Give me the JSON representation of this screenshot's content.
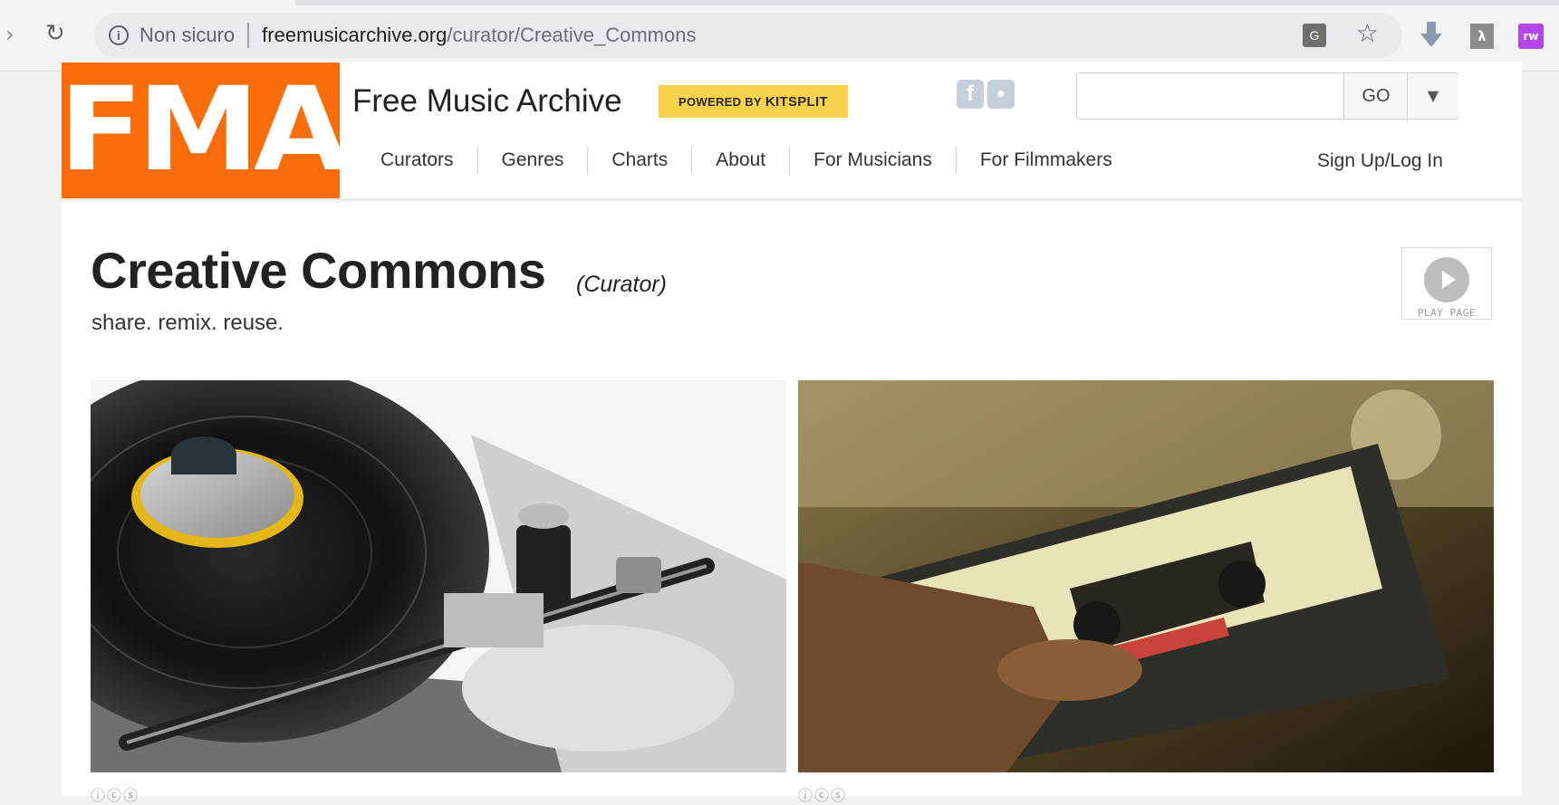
{
  "browser": {
    "security_label": "Non sicuro",
    "url_domain": "freemusicarchive.org",
    "url_path": "/curator/Creative_Commons",
    "icons": [
      "forward-icon",
      "reload-icon",
      "info-icon",
      "translate-icon",
      "star-icon",
      "download-extension-icon",
      "pdf-extension-icon",
      "rw-extension-icon"
    ],
    "rw_label": "rw"
  },
  "header": {
    "logo_text": "FMA",
    "site_name": "Free Music Archive",
    "powered_by": "POWERED BY",
    "powered_brand": "KITSPLIT",
    "search": {
      "placeholder": "",
      "button_label": "GO"
    },
    "nav": [
      "Curators",
      "Genres",
      "Charts",
      "About",
      "For Musicians",
      "For Filmmakers"
    ],
    "signup_label": "Sign Up/Log In",
    "accent_color": "#fb6d0a",
    "badge_color": "#f7d24b"
  },
  "main": {
    "title": "Creative Commons",
    "title_tag": "(Curator)",
    "tagline": "share. remix. reuse.",
    "play_label": "PLAY PAGE",
    "photos": [
      {
        "subject": "turntable",
        "license_icons": "ⓘⓒⓢ"
      },
      {
        "subject": "cassette tape",
        "license_icons": "ⓘⓒⓢ"
      }
    ]
  }
}
